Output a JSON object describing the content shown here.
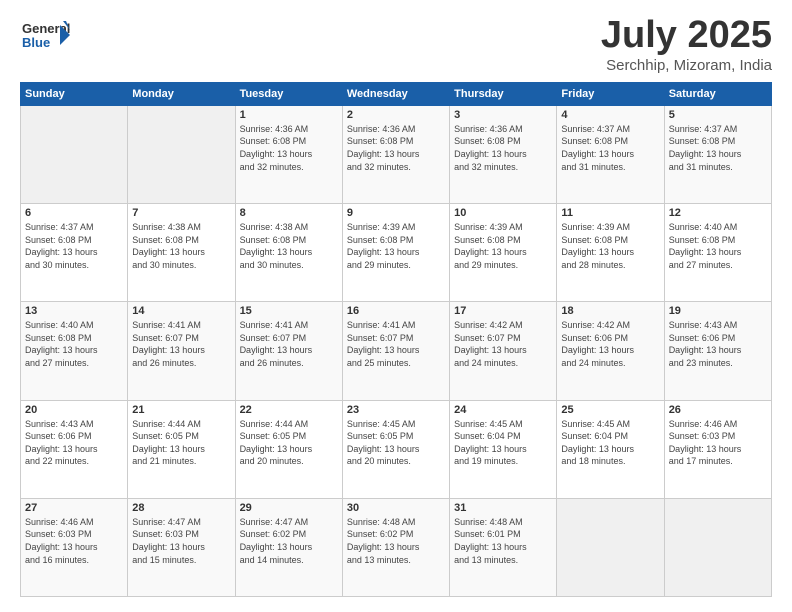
{
  "header": {
    "logo": {
      "general": "General",
      "blue": "Blue"
    },
    "title": "July 2025",
    "location": "Serchhip, Mizoram, India"
  },
  "calendar": {
    "days_of_week": [
      "Sunday",
      "Monday",
      "Tuesday",
      "Wednesday",
      "Thursday",
      "Friday",
      "Saturday"
    ],
    "weeks": [
      [
        {
          "day": "",
          "info": ""
        },
        {
          "day": "",
          "info": ""
        },
        {
          "day": "1",
          "info": "Sunrise: 4:36 AM\nSunset: 6:08 PM\nDaylight: 13 hours\nand 32 minutes."
        },
        {
          "day": "2",
          "info": "Sunrise: 4:36 AM\nSunset: 6:08 PM\nDaylight: 13 hours\nand 32 minutes."
        },
        {
          "day": "3",
          "info": "Sunrise: 4:36 AM\nSunset: 6:08 PM\nDaylight: 13 hours\nand 32 minutes."
        },
        {
          "day": "4",
          "info": "Sunrise: 4:37 AM\nSunset: 6:08 PM\nDaylight: 13 hours\nand 31 minutes."
        },
        {
          "day": "5",
          "info": "Sunrise: 4:37 AM\nSunset: 6:08 PM\nDaylight: 13 hours\nand 31 minutes."
        }
      ],
      [
        {
          "day": "6",
          "info": "Sunrise: 4:37 AM\nSunset: 6:08 PM\nDaylight: 13 hours\nand 30 minutes."
        },
        {
          "day": "7",
          "info": "Sunrise: 4:38 AM\nSunset: 6:08 PM\nDaylight: 13 hours\nand 30 minutes."
        },
        {
          "day": "8",
          "info": "Sunrise: 4:38 AM\nSunset: 6:08 PM\nDaylight: 13 hours\nand 30 minutes."
        },
        {
          "day": "9",
          "info": "Sunrise: 4:39 AM\nSunset: 6:08 PM\nDaylight: 13 hours\nand 29 minutes."
        },
        {
          "day": "10",
          "info": "Sunrise: 4:39 AM\nSunset: 6:08 PM\nDaylight: 13 hours\nand 29 minutes."
        },
        {
          "day": "11",
          "info": "Sunrise: 4:39 AM\nSunset: 6:08 PM\nDaylight: 13 hours\nand 28 minutes."
        },
        {
          "day": "12",
          "info": "Sunrise: 4:40 AM\nSunset: 6:08 PM\nDaylight: 13 hours\nand 27 minutes."
        }
      ],
      [
        {
          "day": "13",
          "info": "Sunrise: 4:40 AM\nSunset: 6:08 PM\nDaylight: 13 hours\nand 27 minutes."
        },
        {
          "day": "14",
          "info": "Sunrise: 4:41 AM\nSunset: 6:07 PM\nDaylight: 13 hours\nand 26 minutes."
        },
        {
          "day": "15",
          "info": "Sunrise: 4:41 AM\nSunset: 6:07 PM\nDaylight: 13 hours\nand 26 minutes."
        },
        {
          "day": "16",
          "info": "Sunrise: 4:41 AM\nSunset: 6:07 PM\nDaylight: 13 hours\nand 25 minutes."
        },
        {
          "day": "17",
          "info": "Sunrise: 4:42 AM\nSunset: 6:07 PM\nDaylight: 13 hours\nand 24 minutes."
        },
        {
          "day": "18",
          "info": "Sunrise: 4:42 AM\nSunset: 6:06 PM\nDaylight: 13 hours\nand 24 minutes."
        },
        {
          "day": "19",
          "info": "Sunrise: 4:43 AM\nSunset: 6:06 PM\nDaylight: 13 hours\nand 23 minutes."
        }
      ],
      [
        {
          "day": "20",
          "info": "Sunrise: 4:43 AM\nSunset: 6:06 PM\nDaylight: 13 hours\nand 22 minutes."
        },
        {
          "day": "21",
          "info": "Sunrise: 4:44 AM\nSunset: 6:05 PM\nDaylight: 13 hours\nand 21 minutes."
        },
        {
          "day": "22",
          "info": "Sunrise: 4:44 AM\nSunset: 6:05 PM\nDaylight: 13 hours\nand 20 minutes."
        },
        {
          "day": "23",
          "info": "Sunrise: 4:45 AM\nSunset: 6:05 PM\nDaylight: 13 hours\nand 20 minutes."
        },
        {
          "day": "24",
          "info": "Sunrise: 4:45 AM\nSunset: 6:04 PM\nDaylight: 13 hours\nand 19 minutes."
        },
        {
          "day": "25",
          "info": "Sunrise: 4:45 AM\nSunset: 6:04 PM\nDaylight: 13 hours\nand 18 minutes."
        },
        {
          "day": "26",
          "info": "Sunrise: 4:46 AM\nSunset: 6:03 PM\nDaylight: 13 hours\nand 17 minutes."
        }
      ],
      [
        {
          "day": "27",
          "info": "Sunrise: 4:46 AM\nSunset: 6:03 PM\nDaylight: 13 hours\nand 16 minutes."
        },
        {
          "day": "28",
          "info": "Sunrise: 4:47 AM\nSunset: 6:03 PM\nDaylight: 13 hours\nand 15 minutes."
        },
        {
          "day": "29",
          "info": "Sunrise: 4:47 AM\nSunset: 6:02 PM\nDaylight: 13 hours\nand 14 minutes."
        },
        {
          "day": "30",
          "info": "Sunrise: 4:48 AM\nSunset: 6:02 PM\nDaylight: 13 hours\nand 13 minutes."
        },
        {
          "day": "31",
          "info": "Sunrise: 4:48 AM\nSunset: 6:01 PM\nDaylight: 13 hours\nand 13 minutes."
        },
        {
          "day": "",
          "info": ""
        },
        {
          "day": "",
          "info": ""
        }
      ]
    ]
  }
}
